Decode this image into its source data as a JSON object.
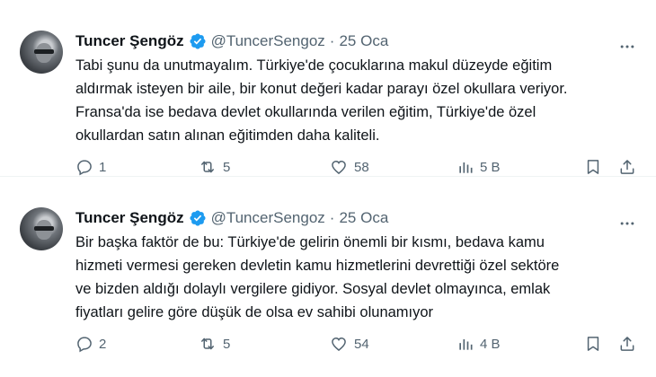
{
  "tweets": [
    {
      "name": "Tuncer Şengöz",
      "handle": "@TuncerSengoz",
      "separator": "·",
      "date": "25 Oca",
      "lines": [
        "Tabi şunu da unutmayalım. Türkiye'de çocuklarına makul düzeyde eğitim",
        "aldırmak isteyen bir aile, bir konut değeri kadar parayı özel okullara veriyor.",
        "Fransa'da ise bedava devlet okullarında verilen eğitim, Türkiye'de özel",
        "okullardan satın alınan eğitimden daha kaliteli."
      ],
      "replies": "1",
      "retweets": "5",
      "likes": "58",
      "views": "5 B"
    },
    {
      "name": "Tuncer Şengöz",
      "handle": "@TuncerSengoz",
      "separator": "·",
      "date": "25 Oca",
      "lines": [
        "Bir başka faktör de bu: Türkiye'de gelirin önemli bir kısmı, bedava kamu",
        "hizmeti vermesi gereken devletin kamu hizmetlerini devrettiği özel sektöre",
        "ve bizden aldığı dolaylı vergilere gidiyor. Sosyal devlet olmayınca, emlak",
        "fiyatları gelire göre düşük de olsa ev sahibi olunamıyor"
      ],
      "replies": "2",
      "retweets": "5",
      "likes": "54",
      "views": "4 B"
    }
  ],
  "icons": {
    "verified": "verified-badge-icon",
    "more": "more-options-icon",
    "reply": "reply-icon",
    "retweet": "retweet-icon",
    "like": "heart-icon",
    "views": "views-icon",
    "bookmark": "bookmark-icon",
    "share": "share-icon"
  },
  "colors": {
    "text": "#0f1419",
    "secondary": "#536471",
    "verified": "#1d9bf0"
  }
}
